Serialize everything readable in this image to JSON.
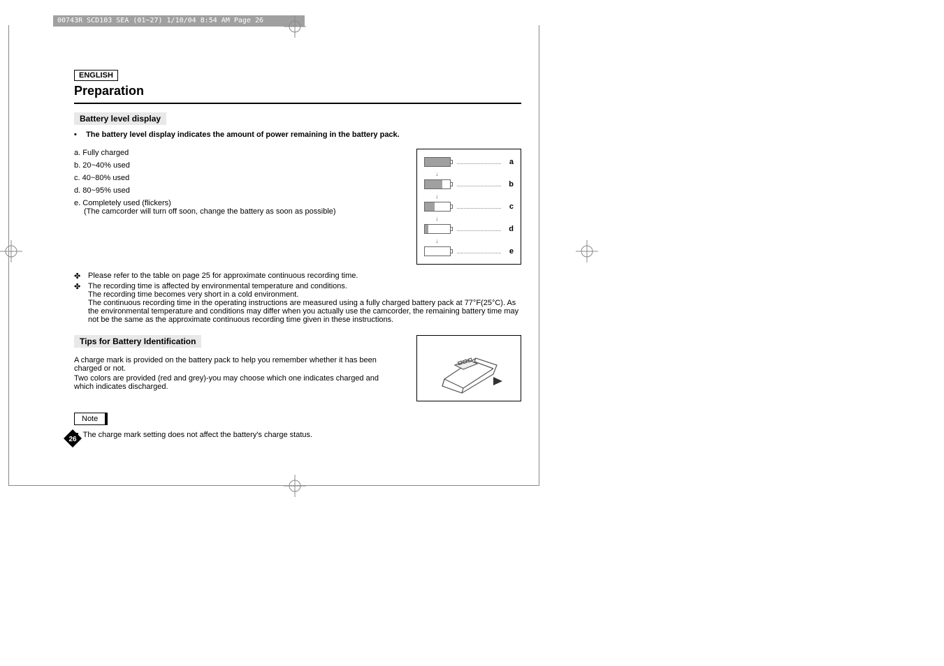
{
  "header": "00743R SCD103 SEA (01~27)  1/10/04 8:54 AM  Page 26",
  "language": "ENGLISH",
  "title": "Preparation",
  "section1": {
    "label": "Battery level display",
    "intro": "The battery level display indicates the amount of power remaining in the battery pack.",
    "items": [
      {
        "letter": "a.",
        "text": "Fully charged"
      },
      {
        "letter": "b.",
        "text": "20~40% used"
      },
      {
        "letter": "c.",
        "text": "40~80% used"
      },
      {
        "letter": "d.",
        "text": "80~95% used"
      },
      {
        "letter": "e.",
        "text": "Completely used (flickers)",
        "sub": "(The camcorder will turn off soon, change the battery as soon as possible)"
      }
    ],
    "bullets": [
      "Please refer to the table on page 25 for approximate continuous recording time.",
      "The recording time is affected by environmental temperature and conditions.\nThe recording time becomes very short in a cold environment.\nThe continuous recording time in the operating instructions are measured using a fully charged battery pack at 77°F(25°C). As the environmental temperature and conditions may differ when you actually use the camcorder, the remaining battery time may not be the same as the approximate continuous recording time given in these instructions."
    ],
    "diagram_labels": [
      "a",
      "b",
      "c",
      "d",
      "e"
    ]
  },
  "section2": {
    "label": "Tips for Battery Identification",
    "text1": "A charge mark is provided on the battery pack to help you remember whether it has been charged or not.",
    "text2": "Two colors are provided (red and grey)-you may choose which one indicates charged and which indicates discharged."
  },
  "note": {
    "label": "Note",
    "text": "The charge mark setting does not affect the battery's charge status."
  },
  "page_number": "26"
}
